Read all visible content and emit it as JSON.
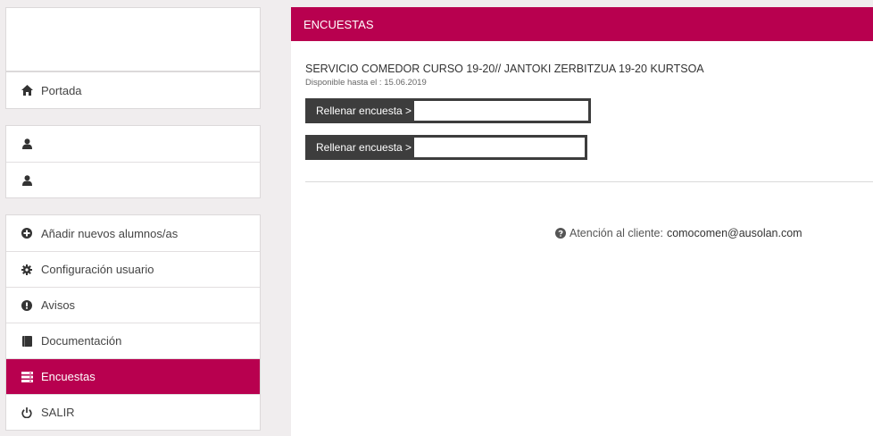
{
  "sidebar": {
    "home": {
      "label": "Portada",
      "icon": "home-icon"
    },
    "users": [
      {
        "label": "",
        "icon": "user-icon"
      },
      {
        "label": "",
        "icon": "user-icon"
      }
    ],
    "menu": [
      {
        "label": "Añadir nuevos alumnos/as",
        "icon": "plus-circle-icon"
      },
      {
        "label": "Configuración usuario",
        "icon": "gear-icon"
      },
      {
        "label": "Avisos",
        "icon": "alert-icon"
      },
      {
        "label": "Documentación",
        "icon": "book-icon"
      },
      {
        "label": "Encuestas",
        "icon": "list-icon",
        "active": true
      },
      {
        "label": "SALIR",
        "icon": "power-icon"
      }
    ]
  },
  "main": {
    "header": "ENCUESTAS",
    "survey": {
      "title": "SERVICIO COMEDOR CURSO 19-20// JANTOKI ZERBITZUA 19-20 KURTSOA",
      "available": "Disponible hasta el : 15.06.2019",
      "buttons": [
        "Rellenar encuesta >",
        "Rellenar encuesta >"
      ]
    },
    "support": {
      "label": "Atención al cliente:",
      "email": "comocomen@ausolan.com"
    }
  },
  "colors": {
    "accent": "#b8004f",
    "button": "#3d3d3d"
  }
}
